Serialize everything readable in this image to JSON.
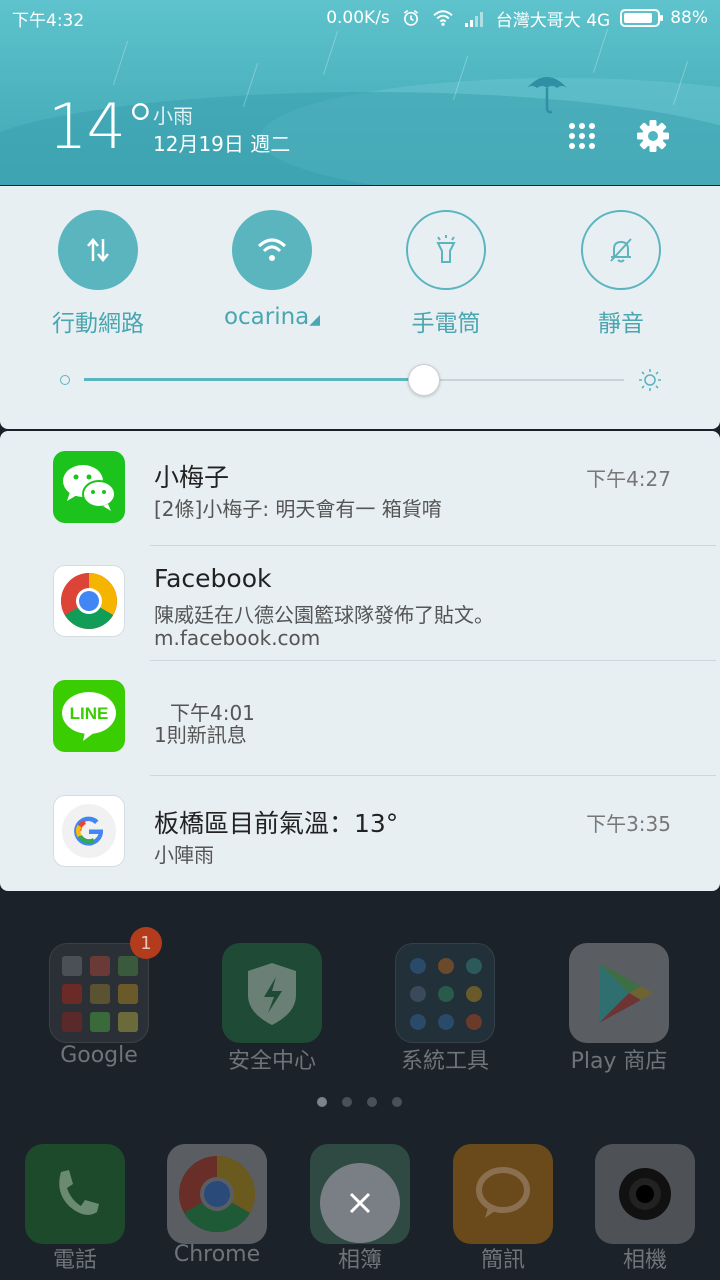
{
  "status_bar": {
    "time": "下午4:32",
    "net_speed": "0.00K/s",
    "carrier": "台灣大哥大 4G",
    "battery": "88%",
    "battery_level": 0.88
  },
  "weather": {
    "temperature": "14°",
    "condition": "小雨",
    "date": "12月19日 週二"
  },
  "quick_settings": {
    "toggles": [
      {
        "label": "行動網路",
        "state": "on",
        "icon": "mobile-data-icon"
      },
      {
        "label": "ocarina",
        "state": "on",
        "icon": "wifi-icon"
      },
      {
        "label": "手電筒",
        "state": "off",
        "icon": "flashlight-icon"
      },
      {
        "label": "靜音",
        "state": "off",
        "icon": "mute-bell-icon"
      }
    ],
    "brightness_level": 0.63
  },
  "notifications": [
    {
      "app": "WeChat",
      "title": "小梅子",
      "time": "下午4:27",
      "text": "[2條]小梅子: 明天會有一 箱貨唷",
      "sub": ""
    },
    {
      "app": "Chrome",
      "title": "Facebook",
      "time": "",
      "text": "陳威廷在八德公園籃球隊發佈了貼文。",
      "sub": "m.facebook.com"
    },
    {
      "app": "LINE",
      "title": "",
      "time": "下午4:01",
      "text": "1則新訊息",
      "sub": "",
      "line_logo": "LINE"
    },
    {
      "app": "Google",
      "title": "板橋區目前氣溫：13°",
      "time": "下午3:35",
      "text": "小陣雨",
      "sub": ""
    }
  ],
  "home": {
    "apps": [
      {
        "label": "Google",
        "badge": "1"
      },
      {
        "label": "安全中心"
      },
      {
        "label": "系統工具"
      },
      {
        "label": "Play 商店"
      }
    ],
    "dock": [
      {
        "label": "電話"
      },
      {
        "label": "Chrome"
      },
      {
        "label": "相簿"
      },
      {
        "label": "簡訊"
      },
      {
        "label": "相機"
      }
    ],
    "page_count": 4,
    "current_page": 1
  },
  "colors": {
    "accent": "#5ab5bf",
    "header": "#4fb5c0",
    "panel": "#e8eff2"
  }
}
